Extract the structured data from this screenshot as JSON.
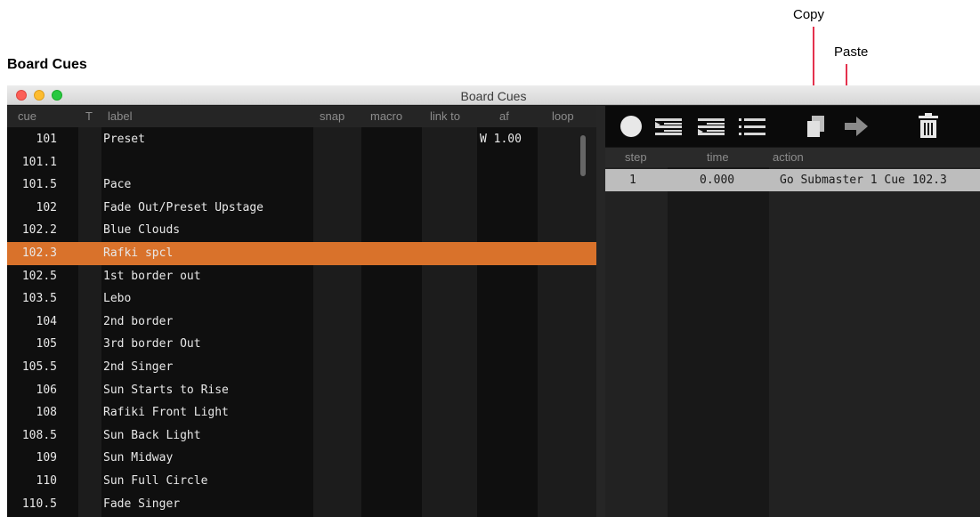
{
  "doc_title": "Board Cues",
  "callouts": {
    "copy": "Copy",
    "paste": "Paste"
  },
  "window": {
    "title": "Board Cues"
  },
  "cue_columns": [
    "cue",
    "T",
    "label",
    "snap",
    "macro",
    "link to",
    "af",
    "loop"
  ],
  "cues": [
    {
      "cue": "101",
      "label": "Preset",
      "af": "W 1.00"
    },
    {
      "cue": "101.1",
      "label": "",
      "af": ""
    },
    {
      "cue": "101.5",
      "label": "Pace",
      "af": ""
    },
    {
      "cue": "102",
      "label": "Fade Out/Preset Upstage",
      "af": ""
    },
    {
      "cue": "102.2",
      "label": "Blue Clouds",
      "af": ""
    },
    {
      "cue": "102.3",
      "label": "Rafki spcl",
      "af": "",
      "selected": true
    },
    {
      "cue": "102.5",
      "label": "1st border out",
      "af": ""
    },
    {
      "cue": "103.5",
      "label": "Lebo",
      "af": ""
    },
    {
      "cue": "104",
      "label": "2nd border",
      "af": ""
    },
    {
      "cue": "105",
      "label": "3rd border Out",
      "af": ""
    },
    {
      "cue": "105.5",
      "label": "2nd Singer",
      "af": ""
    },
    {
      "cue": "106",
      "label": "Sun Starts to Rise",
      "af": ""
    },
    {
      "cue": "108",
      "label": "Rafiki Front Light",
      "af": ""
    },
    {
      "cue": "108.5",
      "label": "Sun Back Light",
      "af": ""
    },
    {
      "cue": "109",
      "label": "Sun Midway",
      "af": ""
    },
    {
      "cue": "110",
      "label": "Sun Full Circle",
      "af": ""
    },
    {
      "cue": "110.5",
      "label": "Fade Singer",
      "af": ""
    }
  ],
  "toolbar_icons": [
    "record-icon",
    "insert-before-icon",
    "insert-after-icon",
    "list-icon",
    "copy-icon",
    "paste-icon",
    "trash-icon"
  ],
  "step_columns": [
    "step",
    "time",
    "action"
  ],
  "steps": [
    {
      "step": "1",
      "time": "0.000",
      "action": "Go Submaster 1 Cue 102.3"
    }
  ],
  "colors": {
    "selected_row": "#d9722b",
    "step_row": "#bdbdbd",
    "callout_line": "#e4314d"
  }
}
